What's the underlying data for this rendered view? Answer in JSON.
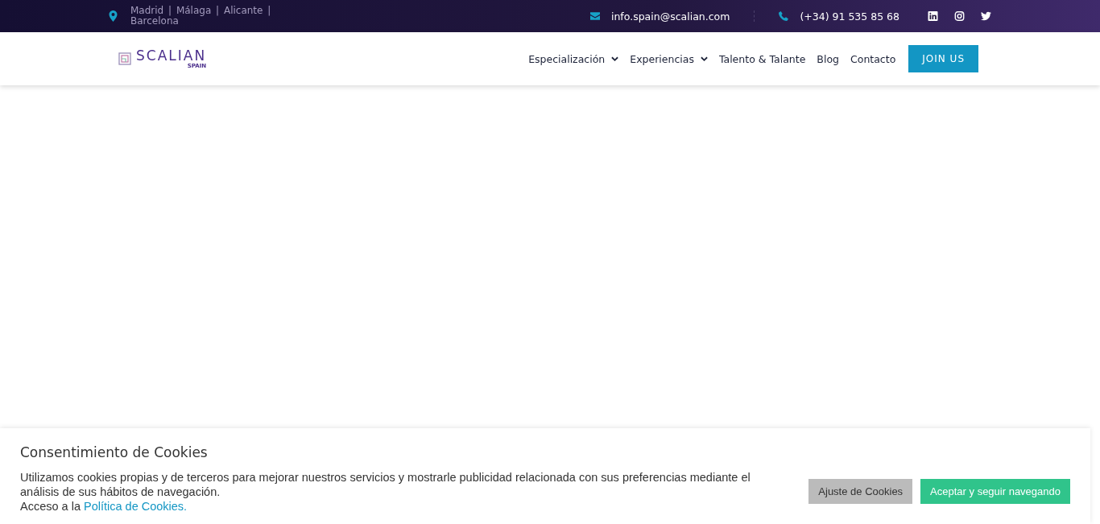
{
  "top_bar": {
    "locations": "Madrid  |  Málaga |  Alicante | Barcelona",
    "email": "info.spain@scalian.com",
    "phone": "(+34) 91 535 85 68"
  },
  "header": {
    "logo": {
      "name": "SCALIAN",
      "tagline": "SPAIN"
    },
    "nav": [
      {
        "label": "Especialización",
        "has_menu": true
      },
      {
        "label": "Experiencias",
        "has_menu": true
      },
      {
        "label": "Talento & Talante",
        "has_menu": false
      },
      {
        "label": "Blog",
        "has_menu": false
      },
      {
        "label": "Contacto",
        "has_menu": false
      }
    ],
    "cta": "JOIN US"
  },
  "cookie_banner": {
    "title": "Consentimiento de Cookies",
    "text": "Utilizamos cookies propias y de terceros para mejorar nuestros servicios y mostrarle publicidad relacionada con sus preferencias mediante el análisis de sus hábitos de navegación.",
    "link_prefix": "Acceso a la",
    "link": "Política de Cookies.",
    "buttons": [
      {
        "label": "Ajuste de Cookies",
        "kind": "settings"
      },
      {
        "label": "Aceptar y seguir navegando",
        "kind": "accept"
      }
    ]
  }
}
